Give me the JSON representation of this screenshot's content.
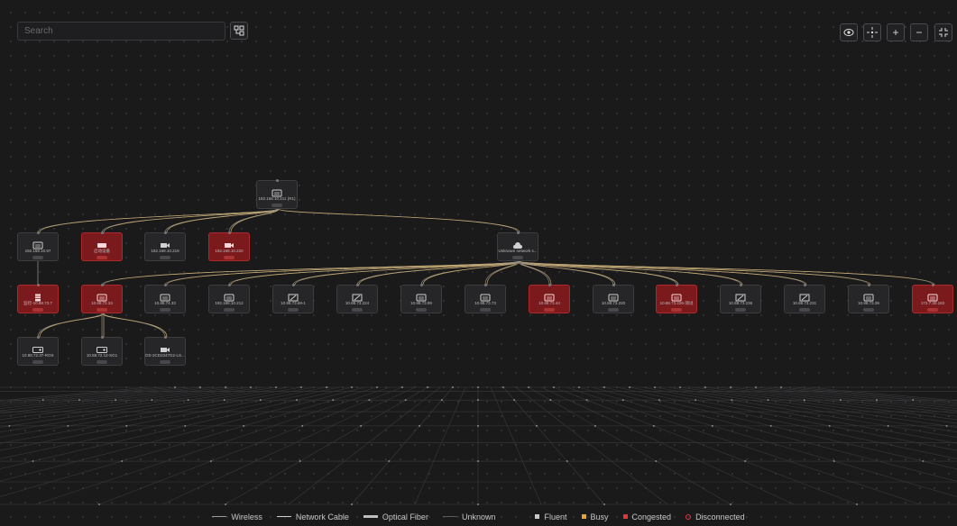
{
  "search": {
    "placeholder": "Search"
  },
  "toolbar": {
    "layout_icon": "layout-tree-icon",
    "view_icon": "eye-icon",
    "center_icon": "locate-icon",
    "zoom_in_label": "+",
    "zoom_out_label": "−",
    "fullscreen_icon": "collapse-icon"
  },
  "colors": {
    "background": "#1a1a1b",
    "node": "#262628",
    "node_border": "#3d3d40",
    "congested": "#e0353b",
    "busy": "#e8a33a",
    "fluent": "#c8c8c8"
  },
  "nodes": {
    "root": {
      "label": "192.168.10.211 (R1)",
      "icon": "router-icon",
      "status": "normal"
    },
    "l1": [
      {
        "label": "192.168.10.97",
        "icon": "router-icon",
        "status": "normal"
      },
      {
        "label": "启动设备",
        "icon": "switch-icon",
        "status": "congested"
      },
      {
        "label": "192.168.10.219",
        "icon": "camera-icon",
        "status": "normal"
      },
      {
        "label": "192.168.10.220",
        "icon": "camera-icon",
        "status": "congested"
      },
      {
        "label": "Unknown network s...",
        "icon": "cloud-icon",
        "status": "normal"
      }
    ],
    "l2": [
      {
        "label": "监控-10.88.73.7",
        "icon": "server-icon",
        "status": "congested"
      },
      {
        "label": "10.88.72.33",
        "icon": "router-icon",
        "status": "congested"
      },
      {
        "label": "10.88.74.33",
        "icon": "router-icon",
        "status": "normal"
      },
      {
        "label": "192.168.10.212",
        "icon": "router-icon",
        "status": "normal"
      },
      {
        "label": "10.88.73.69-1",
        "icon": "ap-icon",
        "status": "normal"
      },
      {
        "label": "10.88.73.224",
        "icon": "ap-icon",
        "status": "normal"
      },
      {
        "label": "10.88.73.99",
        "icon": "router-icon",
        "status": "normal"
      },
      {
        "label": "10.88.73.73",
        "icon": "router-icon",
        "status": "normal"
      },
      {
        "label": "10.88.73.44",
        "icon": "router-icon",
        "status": "congested"
      },
      {
        "label": "10.88.73.220",
        "icon": "router-icon",
        "status": "normal"
      },
      {
        "label": "10.88.73.226-测试",
        "icon": "router-icon",
        "status": "congested"
      },
      {
        "label": "10.88.73.236",
        "icon": "ap-icon",
        "status": "normal"
      },
      {
        "label": "10.88.73.231",
        "icon": "ap-icon",
        "status": "normal"
      },
      {
        "label": "10.88.73.38",
        "icon": "router-icon",
        "status": "normal"
      },
      {
        "label": "172.7.30.183",
        "icon": "router-icon",
        "status": "congested"
      }
    ],
    "l3": [
      {
        "label": "10.88.72.37-ROS",
        "icon": "nvr-icon",
        "status": "normal"
      },
      {
        "label": "10.88.72.12-SG1",
        "icon": "nvr-icon",
        "status": "normal"
      },
      {
        "label": "DS-2CD2347G2-LS...",
        "icon": "camera-icon",
        "status": "normal"
      }
    ]
  },
  "legend": {
    "wireless": "Wireless",
    "network_cable": "Network Cable",
    "optical_fiber": "Optical Fiber",
    "unknown": "Unknown",
    "fluent": "Fluent",
    "busy": "Busy",
    "congested": "Congested",
    "disconnected": "Disconnected"
  }
}
